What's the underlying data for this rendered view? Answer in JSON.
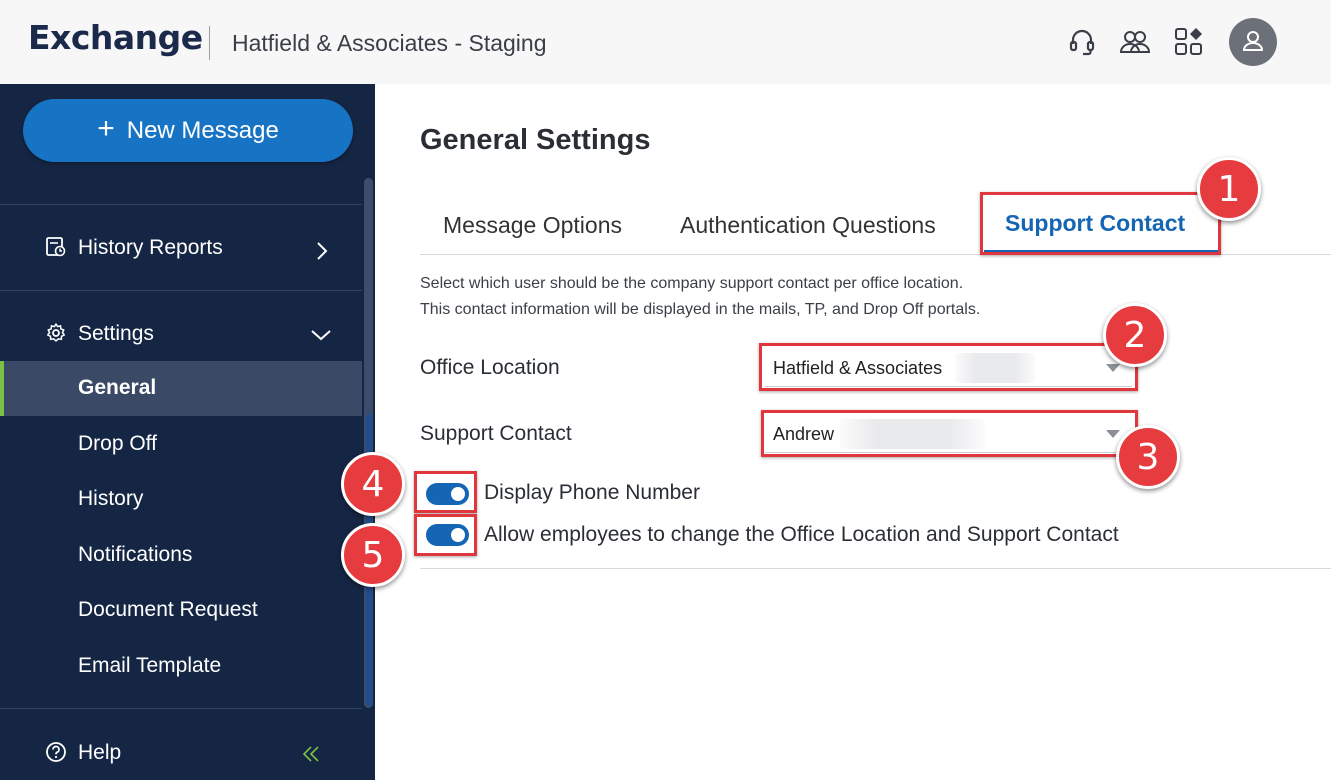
{
  "header": {
    "app_name": "Exchange",
    "org_name": "Hatfield & Associates - Staging",
    "icons": [
      "headset-icon",
      "users-icon",
      "apps-icon",
      "user-avatar-icon"
    ]
  },
  "sidebar": {
    "new_message_label": "New Message",
    "history_reports_label": "History Reports",
    "settings_label": "Settings",
    "sub_items": [
      "General",
      "Drop Off",
      "History",
      "Notifications",
      "Document Request",
      "Email Template"
    ],
    "active_item": "General",
    "help_label": "Help"
  },
  "main": {
    "title": "General Settings",
    "tabs": [
      "Message Options",
      "Authentication Questions",
      "Support Contact"
    ],
    "active_tab": "Support Contact",
    "description_line1": "Select which user should be the company support contact per office location.",
    "description_line2": "This contact information will be displayed in the mails, TP, and Drop Off portals.",
    "office_location": {
      "label": "Office Location",
      "value": "Hatfield & Associates"
    },
    "support_contact": {
      "label": "Support Contact",
      "value": "Andrew"
    },
    "toggles": [
      {
        "label": "Display Phone Number",
        "on": true
      },
      {
        "label": "Allow employees to change the Office Location and Support Contact",
        "on": true
      }
    ]
  },
  "annotations": [
    "1",
    "2",
    "3",
    "4",
    "5"
  ],
  "colors": {
    "sidebar_bg": "#152645",
    "accent_blue": "#1565b5",
    "button_blue": "#1774c4",
    "active_indicator": "#7ac143",
    "callout_red": "#e63b3f"
  }
}
